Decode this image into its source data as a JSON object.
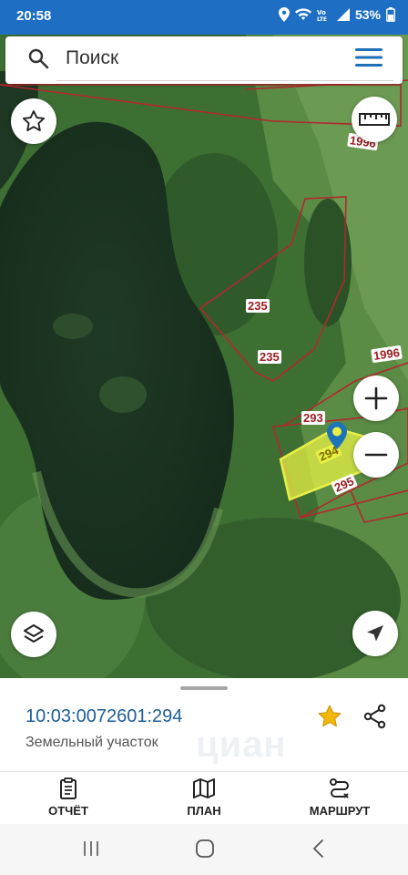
{
  "status_bar": {
    "time": "20:58",
    "battery": "53%",
    "icons": [
      "location-icon",
      "wifi-icon",
      "volte-icon",
      "signal-icon",
      "battery-icon"
    ]
  },
  "search": {
    "placeholder": "Поиск"
  },
  "map": {
    "parcel_labels": [
      {
        "text": "1996",
        "name": "parcel-label-1996-top"
      },
      {
        "text": "235",
        "name": "parcel-label-235-a"
      },
      {
        "text": "235",
        "name": "parcel-label-235-b"
      },
      {
        "text": "1996",
        "name": "parcel-label-1996-right"
      },
      {
        "text": "293",
        "name": "parcel-label-293"
      },
      {
        "text": "294",
        "name": "parcel-label-294"
      },
      {
        "text": "295",
        "name": "parcel-label-295"
      }
    ],
    "selected_parcel": "294",
    "colors": {
      "parcel_border": "#b3282d",
      "selected_fill": "#e8f046",
      "marker": "#1d73b8"
    }
  },
  "details": {
    "cadastral_number": "10:03:0072601:294",
    "parcel_type": "Земельный участок",
    "watermark": "циан"
  },
  "actions": [
    {
      "label": "ОТЧЁТ",
      "icon": "report-icon"
    },
    {
      "label": "ПЛАН",
      "icon": "map-plan-icon"
    },
    {
      "label": "МАРШРУТ",
      "icon": "route-icon"
    }
  ],
  "colors": {
    "status_bar": "#1e6fc4",
    "accent": "#1d5e99",
    "star": "#f2b705"
  }
}
